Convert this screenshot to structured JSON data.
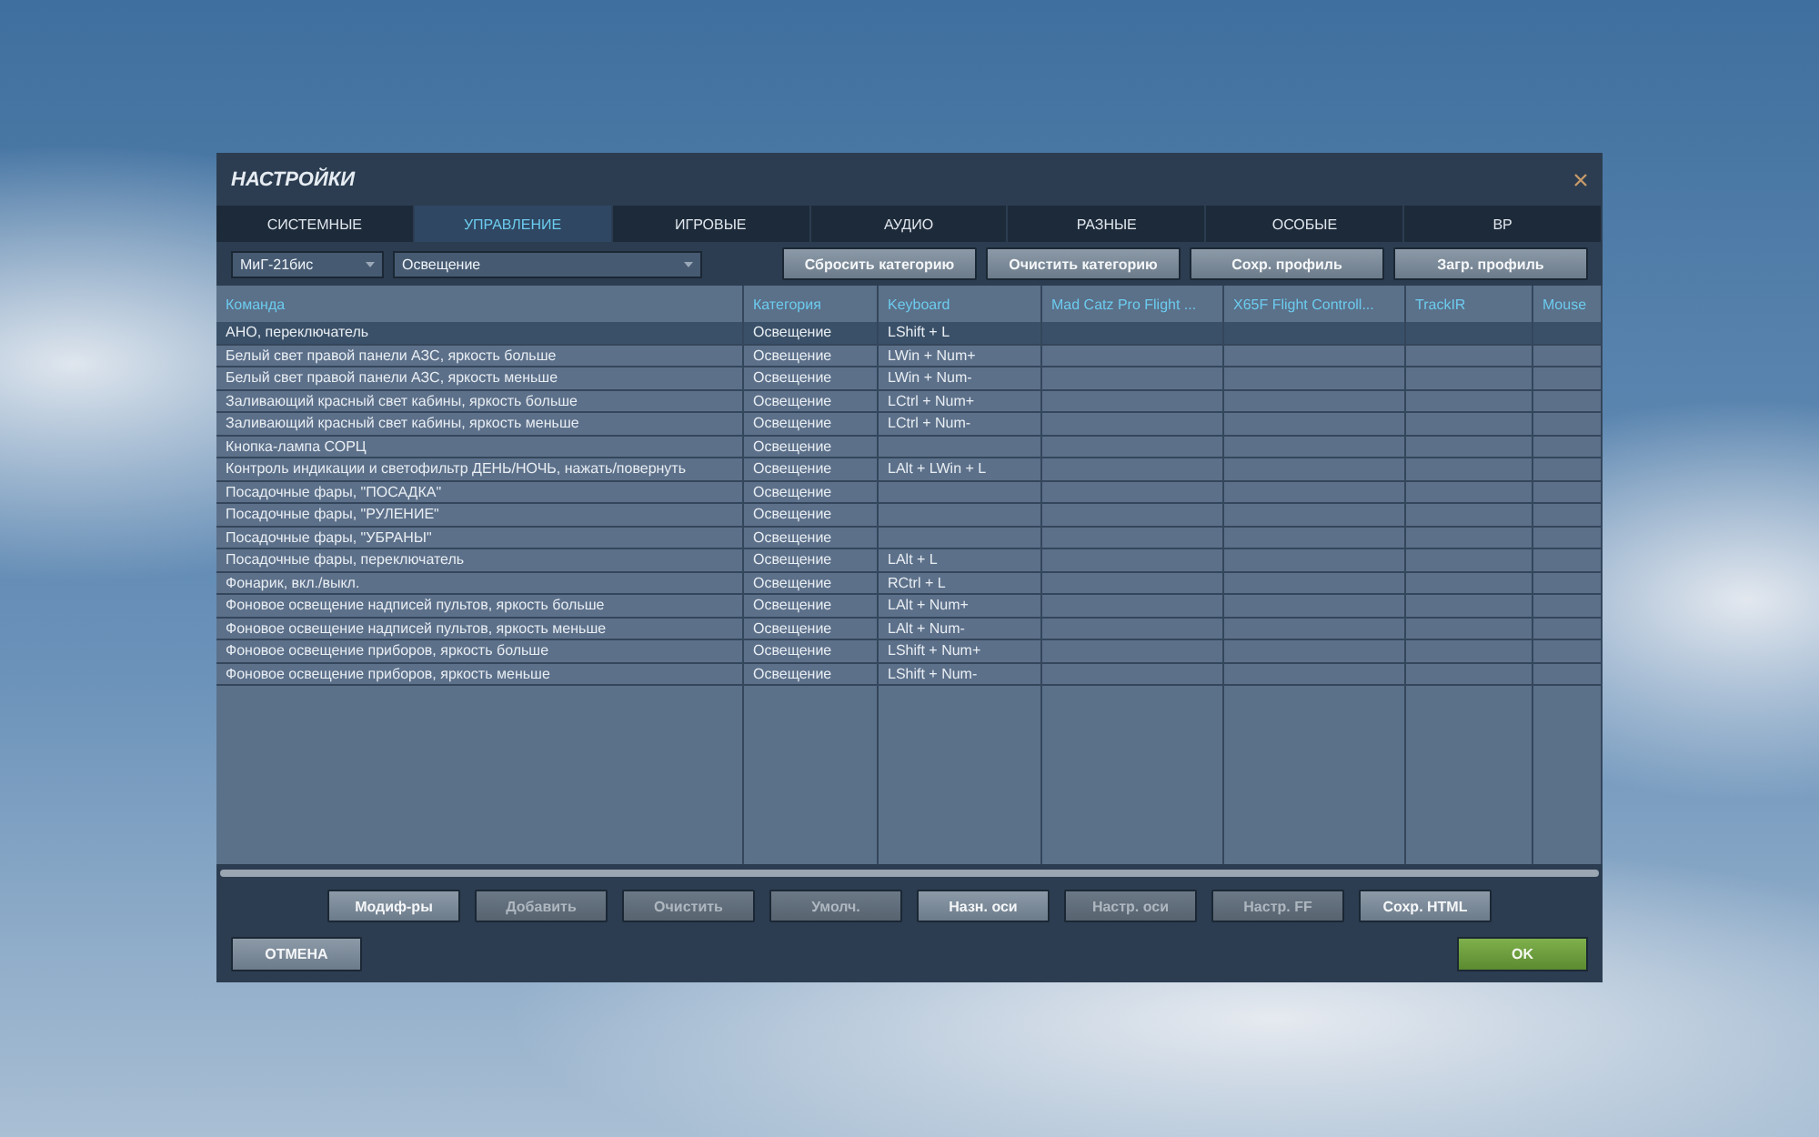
{
  "window": {
    "title": "НАСТРОЙКИ"
  },
  "tabs": [
    {
      "label": "СИСТЕМНЫЕ",
      "selected": false
    },
    {
      "label": "УПРАВЛЕНИЕ",
      "selected": true
    },
    {
      "label": "ИГРОВЫЕ",
      "selected": false
    },
    {
      "label": "АУДИО",
      "selected": false
    },
    {
      "label": "РАЗНЫЕ",
      "selected": false
    },
    {
      "label": "ОСОБЫЕ",
      "selected": false
    },
    {
      "label": "ВР",
      "selected": false
    }
  ],
  "toolbar": {
    "aircraft_dropdown": "МиГ-21бис",
    "category_dropdown": "Освещение",
    "buttons": [
      "Сбросить категорию",
      "Очистить категорию",
      "Сохр. профиль",
      "Загр. профиль"
    ]
  },
  "table": {
    "columns": [
      "Команда",
      "Категория",
      "Keyboard",
      "Mad Catz Pro Flight ...",
      "X65F Flight Controll...",
      "TrackIR",
      "Mouse"
    ],
    "rows": [
      {
        "command": "АНО, переключатель",
        "category": "Освещение",
        "keyboard": "LShift + L",
        "selected": true
      },
      {
        "command": "Белый свет правой панели АЗС, яркость больше",
        "category": "Освещение",
        "keyboard": "LWin + Num+",
        "selected": false
      },
      {
        "command": "Белый свет правой панели АЗС, яркость меньше",
        "category": "Освещение",
        "keyboard": "LWin + Num-",
        "selected": false
      },
      {
        "command": "Заливающий красный свет кабины, яркость больше",
        "category": "Освещение",
        "keyboard": "LCtrl + Num+",
        "selected": false
      },
      {
        "command": "Заливающий красный свет кабины, яркость меньше",
        "category": "Освещение",
        "keyboard": "LCtrl + Num-",
        "selected": false
      },
      {
        "command": "Кнопка-лампа СОРЦ",
        "category": "Освещение",
        "selected": false
      },
      {
        "command": "Контроль индикации и светофильтр ДЕНЬ/НОЧЬ, нажать/повернуть",
        "category": "Освещение",
        "keyboard": "LAlt + LWin + L",
        "selected": false
      },
      {
        "command": "Посадочные фары, \"ПОСАДКА\"",
        "category": "Освещение",
        "selected": false
      },
      {
        "command": "Посадочные фары, \"РУЛЕНИЕ\"",
        "category": "Освещение",
        "selected": false
      },
      {
        "command": "Посадочные фары, \"УБРАНЫ\"",
        "category": "Освещение",
        "selected": false
      },
      {
        "command": "Посадочные фары, переключатель",
        "category": "Освещение",
        "keyboard": "LAlt + L",
        "selected": false
      },
      {
        "command": "Фонарик, вкл./выкл.",
        "category": "Освещение",
        "keyboard": "RCtrl + L",
        "selected": false
      },
      {
        "command": "Фоновое освещение надписей пультов, яркость больше",
        "category": "Освещение",
        "keyboard": "LAlt + Num+",
        "selected": false
      },
      {
        "command": "Фоновое освещение надписей пультов, яркость меньше",
        "category": "Освещение",
        "keyboard": "LAlt + Num-",
        "selected": false
      },
      {
        "command": "Фоновое освещение приборов, яркость больше",
        "category": "Освещение",
        "keyboard": "LShift + Num+",
        "selected": false
      },
      {
        "command": "Фоновое освещение приборов, яркость меньше",
        "category": "Освещение",
        "keyboard": "LShift + Num-",
        "selected": false
      }
    ]
  },
  "action_buttons": [
    {
      "label": "Модиф-ры",
      "disabled": false
    },
    {
      "label": "Добавить",
      "disabled": true
    },
    {
      "label": "Очистить",
      "disabled": true
    },
    {
      "label": "Умолч.",
      "disabled": true
    },
    {
      "label": "Назн. оси",
      "disabled": false
    },
    {
      "label": "Настр. оси",
      "disabled": true
    },
    {
      "label": "Настр. FF",
      "disabled": true
    },
    {
      "label": "Сохр. HTML",
      "disabled": false
    }
  ],
  "footer": {
    "cancel": "ОТМЕНА",
    "ok": "OK"
  }
}
